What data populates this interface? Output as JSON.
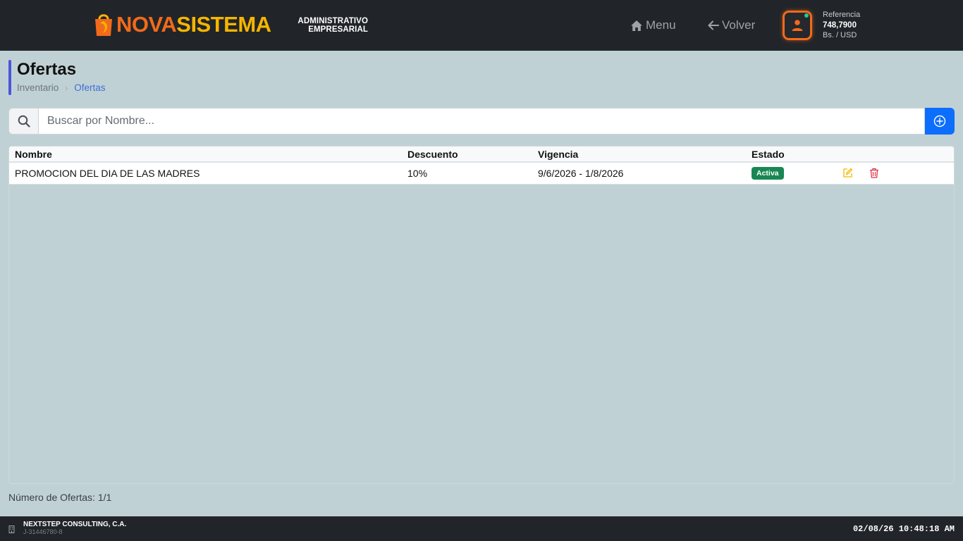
{
  "brand": {
    "name_part1": "NOVA",
    "name_part2": "SISTEMA",
    "subtitle_line1": "ADMINISTRATIVO",
    "subtitle_line2": "EMPRESARIAL",
    "colors": {
      "orange": "#f26a1b",
      "yellow": "#f7b500"
    }
  },
  "header": {
    "menu_label": "Menu",
    "menu_icon": "home-icon",
    "back_label": "Volver",
    "back_icon": "arrow-left-icon",
    "user_icon": "user-icon",
    "reference": {
      "label": "Referencia",
      "rate": "748,7900",
      "unit": "Bs. / USD"
    }
  },
  "page": {
    "title": "Ofertas",
    "breadcrumb": [
      {
        "label": "Inventario"
      },
      {
        "label": "Ofertas",
        "current": true
      }
    ]
  },
  "search": {
    "placeholder": "Buscar por Nombre...",
    "value": "",
    "icon": "search-icon",
    "add_icon": "plus-circle-icon"
  },
  "table": {
    "columns": [
      "Nombre",
      "Descuento",
      "Vigencia",
      "Estado",
      ""
    ],
    "rows": [
      {
        "nombre": "PROMOCION DEL DIA DE LAS MADRES",
        "descuento": "10%",
        "vigencia": "9/6/2026 - 1/8/2026",
        "estado": "Activa",
        "estado_color": "#198754",
        "actions": [
          "edit-icon",
          "trash-icon"
        ]
      }
    ]
  },
  "count_text": "Número de Ofertas: 1/1",
  "footer": {
    "company": "NEXTSTEP CONSULTING, C.A.",
    "rif": "J-31446780-8",
    "icon": "building-icon",
    "datetime": "02/08/26 10:48:18 AM"
  }
}
